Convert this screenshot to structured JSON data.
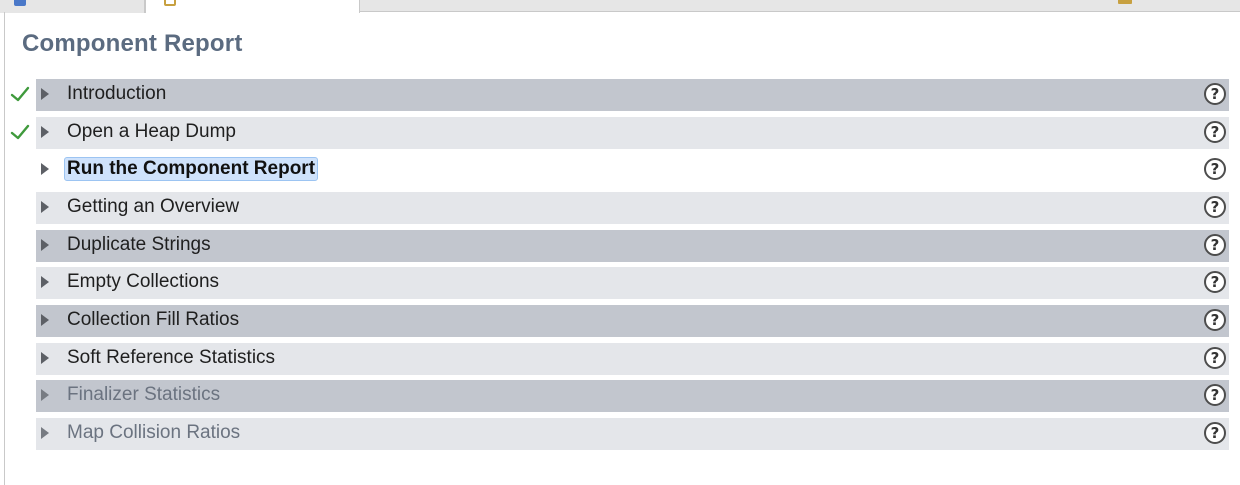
{
  "title": "Component Report",
  "steps": [
    {
      "label": "Introduction",
      "completed": true,
      "style": "dark"
    },
    {
      "label": "Open a Heap Dump",
      "completed": true,
      "style": "light"
    },
    {
      "label": "Run the Component Report",
      "completed": false,
      "style": "plain",
      "active": true
    },
    {
      "label": "Getting an Overview",
      "completed": false,
      "style": "light"
    },
    {
      "label": "Duplicate Strings",
      "completed": false,
      "style": "dark"
    },
    {
      "label": "Empty Collections",
      "completed": false,
      "style": "light"
    },
    {
      "label": "Collection Fill Ratios",
      "completed": false,
      "style": "dark"
    },
    {
      "label": "Soft Reference Statistics",
      "completed": false,
      "style": "light"
    },
    {
      "label": "Finalizer Statistics",
      "completed": false,
      "style": "dark",
      "muted": true
    },
    {
      "label": "Map Collision Ratios",
      "completed": false,
      "style": "light",
      "muted": true
    }
  ],
  "help_symbol": "?",
  "icons": {
    "check": "checkmark-icon",
    "expand": "expand-triangle-icon",
    "help": "help-icon"
  },
  "colors": {
    "title": "#5b6b80",
    "check": "#3f9a3c",
    "row_dark": "#c2c6ce",
    "row_light": "#e4e6ea",
    "highlight": "#cfe2fb"
  }
}
